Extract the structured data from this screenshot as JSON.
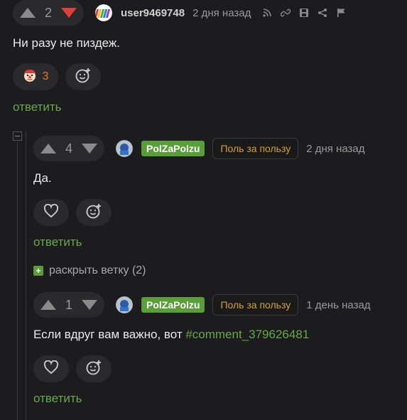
{
  "comment1": {
    "votes": "2",
    "username": "user9469748",
    "time": "2 дня назад",
    "text": "Ни разу не пиздеж.",
    "reaction_count": "3",
    "reply": "ответить"
  },
  "comment2": {
    "votes": "4",
    "username": "PolZaPolzu",
    "badge": "Поль за пользу",
    "time": "2 дня назад",
    "text": "Да.",
    "reply": "ответить"
  },
  "expand_thread": "раскрыть ветку (2)",
  "comment3": {
    "votes": "1",
    "username": "PolZaPolzu",
    "badge": "Поль за пользу",
    "time": "1 день назад",
    "text_prefix": "Если вдруг вам важно, вот ",
    "text_link": "#comment_379626481",
    "reply": "ответить"
  },
  "colors": {
    "background": "#1c1c1e",
    "accent_green": "#67a84b",
    "downvote_red": "#e0403a",
    "badge_text": "#d0a23a"
  },
  "icons": [
    "rss-icon",
    "link-icon",
    "save-icon",
    "share-icon",
    "flag-icon",
    "clown-reaction-icon",
    "add-reaction-icon",
    "heart-icon",
    "collapse-icon",
    "expand-icon"
  ]
}
